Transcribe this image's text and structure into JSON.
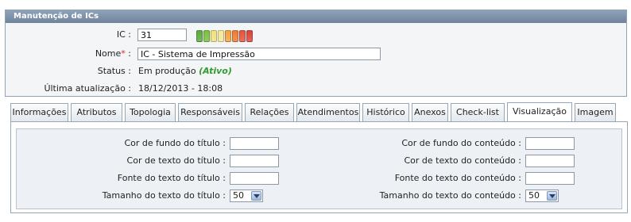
{
  "panel": {
    "title": "Manutenção de ICs",
    "fields": {
      "ic_label": "IC :",
      "ic_value": "31",
      "nome_label": "Nome",
      "nome_required": "*",
      "nome_colon": ":",
      "nome_value": "IC - Sistema de Impressão",
      "status_label": "Status :",
      "status_value": "Em produção",
      "status_active": "(Ativo)",
      "updated_label": "Última atualização :",
      "updated_value": "18/12/2013 - 18:08"
    },
    "priority_leds": [
      "#5aa83a",
      "#7bbf3f",
      "#f1e27a",
      "#f5e79a",
      "#f2a23a",
      "#ee7a2e",
      "#e2523c",
      "#d8433a"
    ]
  },
  "tabs": [
    {
      "label": "Informações"
    },
    {
      "label": "Atributos"
    },
    {
      "label": "Topologia"
    },
    {
      "label": "Responsáveis"
    },
    {
      "label": "Relações"
    },
    {
      "label": "Atendimentos"
    },
    {
      "label": "Histórico"
    },
    {
      "label": "Anexos"
    },
    {
      "label": "Check-list"
    },
    {
      "label": "Visualização"
    },
    {
      "label": "Imagem"
    }
  ],
  "selected_tab": "Visualização",
  "visualizacao": {
    "left": {
      "title_bg_label": "Cor de fundo do título :",
      "title_text_color_label": "Cor de texto do título :",
      "title_font_label": "Fonte do texto do título :",
      "title_size_label": "Tamanho do texto do título :",
      "title_size_value": "50"
    },
    "right": {
      "content_bg_label": "Cor de fundo do conteúdo :",
      "content_text_color_label": "Cor de texto do conteúdo :",
      "content_font_label": "Fonte do texto do conteúdo :",
      "content_size_label": "Tamanho do texto do conteúdo :",
      "content_size_value": "50"
    }
  }
}
